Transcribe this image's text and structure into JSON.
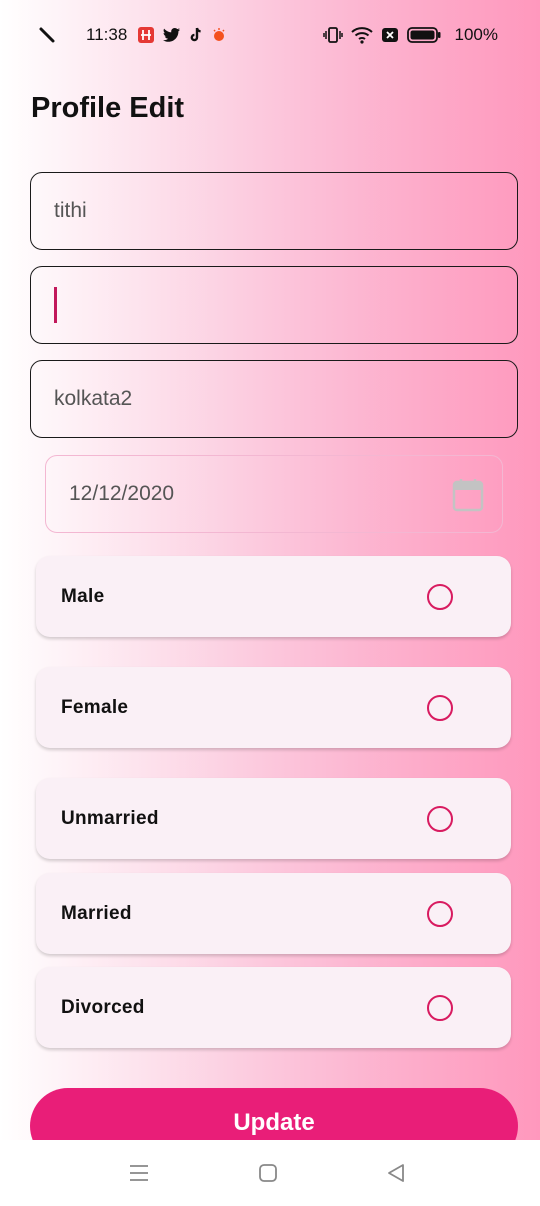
{
  "status_bar": {
    "time": "11:38",
    "battery_percent": "100%",
    "notification_icons": [
      "app-notification-icon",
      "twitter-icon",
      "tiktok-icon",
      "notification-dot-icon"
    ],
    "system_icons": [
      "vibrate-icon",
      "wifi-icon",
      "sim-off-icon",
      "battery-icon"
    ]
  },
  "header": {
    "title": "Profile Edit"
  },
  "form": {
    "name_value": "tithi",
    "second_value": "",
    "address_value": "kolkata2",
    "date_value": "12/12/2020",
    "gender_options": [
      {
        "label": "Male",
        "selected": false
      },
      {
        "label": "Female",
        "selected": false
      }
    ],
    "marital_options": [
      {
        "label": "Unmarried",
        "selected": false
      },
      {
        "label": "Married",
        "selected": false
      },
      {
        "label": "Divorced",
        "selected": false
      }
    ],
    "update_label": "Update"
  },
  "nav": {
    "buttons": [
      "recents-icon",
      "home-icon",
      "back-icon"
    ]
  },
  "colors": {
    "accent": "#e91e78",
    "radio": "#d81b60",
    "card_bg": "#faf0f6",
    "gradient_end": "#ff98bd"
  }
}
